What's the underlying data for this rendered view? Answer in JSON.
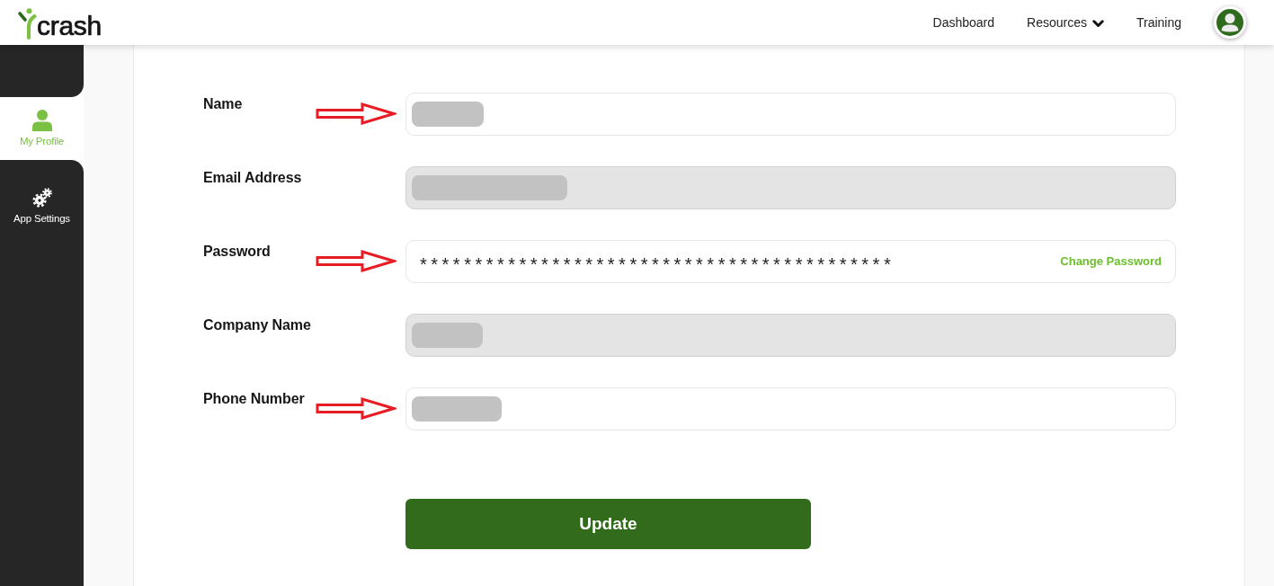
{
  "header": {
    "logo_text": "crash",
    "nav": [
      {
        "label": "Dashboard",
        "kind": "link"
      },
      {
        "label": "Resources",
        "kind": "dropdown"
      },
      {
        "label": "Training",
        "kind": "link"
      }
    ]
  },
  "sidebar": {
    "items": [
      {
        "label": "My Profile",
        "kind": "profile",
        "selected": true
      },
      {
        "label": "App Settings",
        "kind": "settings",
        "selected": false
      }
    ]
  },
  "form": {
    "fields": [
      {
        "label": "Name",
        "kind": "redacted",
        "disabled": false,
        "annotated": true
      },
      {
        "label": "Email Address",
        "kind": "redacted",
        "disabled": true,
        "annotated": false
      },
      {
        "label": "Password",
        "kind": "password",
        "value": "*******************************************",
        "action": "Change Password",
        "disabled": false,
        "annotated": true
      },
      {
        "label": "Company Name",
        "kind": "redacted",
        "disabled": true,
        "annotated": false
      },
      {
        "label": "Phone Number",
        "kind": "redacted",
        "disabled": false,
        "annotated": true
      }
    ],
    "submit": "Update"
  }
}
